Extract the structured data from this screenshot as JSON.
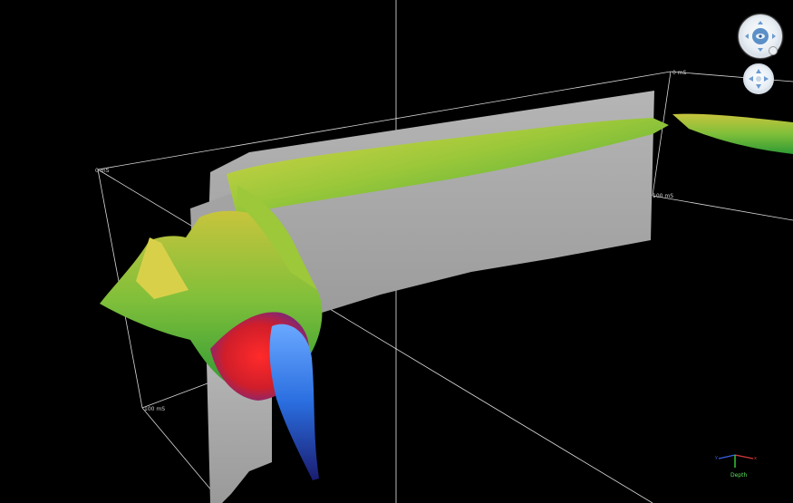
{
  "viewer": {
    "axis_labels": {
      "top_left": "0 mS",
      "top_right": "0 mS",
      "mid_right": "100 mS",
      "bottom_left": "100 mS"
    },
    "orientation": {
      "depth_label": "Depth",
      "x_color": "#d23a3a",
      "y_color": "#3a5ee0",
      "z_color": "#3ad23a"
    },
    "navigation": {
      "orbit_icon": "orbit-control-icon",
      "pan_icon": "pan-control-icon"
    },
    "colors": {
      "background": "#000000",
      "section_plane": "#a8a8a8",
      "surface_high": "#c8c23a",
      "surface_mid": "#3fa83a",
      "surface_low_red": "#d21e1e",
      "surface_deep_blue": "#2a7fe0",
      "bounding_box": "#ffffff"
    }
  }
}
